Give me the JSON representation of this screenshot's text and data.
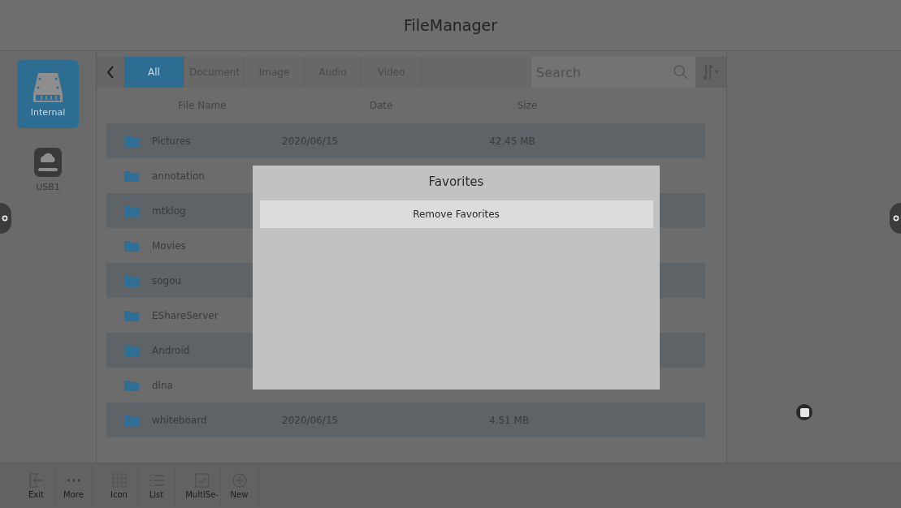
{
  "window": {
    "title": "FileManager"
  },
  "sidebar": {
    "items": [
      {
        "label": "Internal",
        "kind": "internal",
        "selected": true
      },
      {
        "label": "USB1",
        "kind": "usb",
        "selected": false
      }
    ]
  },
  "tabs": [
    {
      "label": "All",
      "selected": true
    },
    {
      "label": "Document",
      "selected": false
    },
    {
      "label": "Image",
      "selected": false
    },
    {
      "label": "Audio",
      "selected": false
    },
    {
      "label": "Video",
      "selected": false
    }
  ],
  "search": {
    "placeholder": "Search"
  },
  "table": {
    "columns": [
      "File Name",
      "Date",
      "Size"
    ],
    "rows": [
      {
        "name": "Pictures",
        "date": "2020/06/15",
        "size": "42.45 MB"
      },
      {
        "name": "annotation"
      },
      {
        "name": "mtklog"
      },
      {
        "name": "Movies"
      },
      {
        "name": "sogou"
      },
      {
        "name": "EShareServer"
      },
      {
        "name": "Android"
      },
      {
        "name": "dlna"
      },
      {
        "name": "whiteboard",
        "date": "2020/06/15",
        "size": "4.51 MB"
      }
    ]
  },
  "toolbar": [
    {
      "label": "Exit",
      "kind": "exit"
    },
    {
      "label": "More",
      "kind": "more"
    },
    {
      "label": "Icon",
      "kind": "grid"
    },
    {
      "label": "List",
      "kind": "list"
    },
    {
      "label": "MultiSe-",
      "kind": "check"
    },
    {
      "label": "New",
      "kind": "new"
    }
  ],
  "dialog": {
    "title": "Favorites",
    "items": [
      "Remove Favorites"
    ]
  }
}
